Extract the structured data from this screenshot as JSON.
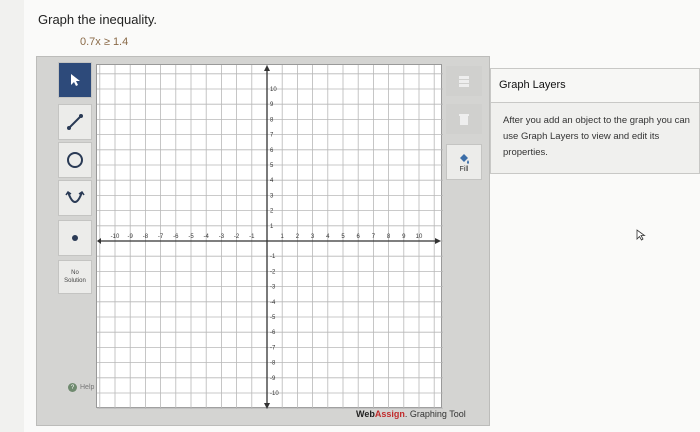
{
  "question": {
    "prompt": "Graph the inequality.",
    "equation": "0.7x ≥ 1.4"
  },
  "toolbar": {
    "tools": [
      {
        "name": "pointer",
        "icon": "arrow-pointer-icon",
        "active": true
      },
      {
        "name": "line",
        "icon": "line-tool-icon",
        "active": false
      },
      {
        "name": "circle",
        "icon": "circle-tool-icon",
        "active": false
      },
      {
        "name": "parabola",
        "icon": "parabola-tool-icon",
        "active": false
      },
      {
        "name": "point",
        "icon": "point-tool-icon",
        "active": false
      }
    ],
    "no_solution_line1": "No",
    "no_solution_line2": "Solution",
    "help_label": "Help"
  },
  "side_tools": {
    "fill_label": "Fill"
  },
  "graph": {
    "x_ticks": [
      "-10",
      "-9",
      "-8",
      "-7",
      "-6",
      "-5",
      "-4",
      "-3",
      "-2",
      "-1",
      "1",
      "2",
      "3",
      "4",
      "5",
      "6",
      "7",
      "8",
      "9",
      "10"
    ],
    "y_ticks": [
      "10",
      "9",
      "8",
      "7",
      "6",
      "5",
      "4",
      "3",
      "2",
      "1",
      "-1",
      "-2",
      "-3",
      "-4",
      "-5",
      "-6",
      "-7",
      "-8",
      "-9",
      "-10"
    ]
  },
  "branding": {
    "part1": "Web",
    "part2": "Assign",
    "part3": ". Graphing Tool"
  },
  "layers": {
    "title": "Graph Layers",
    "description": "After you add an object to the graph you can use Graph Layers to view and edit its properties."
  },
  "colors": {
    "active_tool": "#2d4a7a",
    "brand_accent": "#c12c2c",
    "equation_text": "#8a6a48"
  }
}
